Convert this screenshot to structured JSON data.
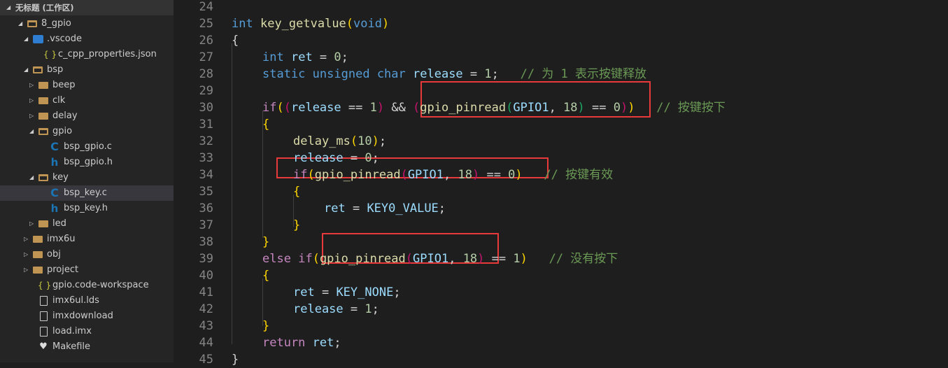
{
  "sidebar": {
    "workspace_title": "无标题 (工作区)",
    "items": [
      {
        "label": "8_gpio",
        "depth": 0,
        "type": "root-folder",
        "expanded": true
      },
      {
        "label": ".vscode",
        "depth": 1,
        "type": "vscode-folder",
        "expanded": true
      },
      {
        "label": "c_cpp_properties.json",
        "depth": 2,
        "type": "json"
      },
      {
        "label": "bsp",
        "depth": 1,
        "type": "folder",
        "expanded": true
      },
      {
        "label": "beep",
        "depth": 2,
        "type": "folder",
        "expanded": false
      },
      {
        "label": "clk",
        "depth": 2,
        "type": "folder",
        "expanded": false
      },
      {
        "label": "delay",
        "depth": 2,
        "type": "folder",
        "expanded": false
      },
      {
        "label": "gpio",
        "depth": 2,
        "type": "folder",
        "expanded": true
      },
      {
        "label": "bsp_gpio.c",
        "depth": 3,
        "type": "c"
      },
      {
        "label": "bsp_gpio.h",
        "depth": 3,
        "type": "h"
      },
      {
        "label": "key",
        "depth": 2,
        "type": "folder",
        "expanded": true
      },
      {
        "label": "bsp_key.c",
        "depth": 3,
        "type": "c",
        "selected": true
      },
      {
        "label": "bsp_key.h",
        "depth": 3,
        "type": "h"
      },
      {
        "label": "led",
        "depth": 2,
        "type": "folder",
        "expanded": false
      },
      {
        "label": "imx6u",
        "depth": 1,
        "type": "folder",
        "expanded": false
      },
      {
        "label": "obj",
        "depth": 1,
        "type": "folder",
        "expanded": false
      },
      {
        "label": "project",
        "depth": 1,
        "type": "folder",
        "expanded": false
      },
      {
        "label": "gpio.code-workspace",
        "depth": 1,
        "type": "json"
      },
      {
        "label": "imx6ul.lds",
        "depth": 1,
        "type": "file"
      },
      {
        "label": "imxdownload",
        "depth": 1,
        "type": "file"
      },
      {
        "label": "load.imx",
        "depth": 1,
        "type": "file"
      },
      {
        "label": "Makefile",
        "depth": 1,
        "type": "makefile"
      }
    ]
  },
  "editor": {
    "lines": [
      {
        "n": "24",
        "indent": 0,
        "tokens": []
      },
      {
        "n": "25",
        "indent": 0,
        "tokens": [
          [
            "int",
            "kw"
          ],
          [
            " ",
            "op"
          ],
          [
            "key_getvalue",
            "fn"
          ],
          [
            "(",
            "b1"
          ],
          [
            "void",
            "kw"
          ],
          [
            ")",
            "b1"
          ]
        ]
      },
      {
        "n": "26",
        "indent": 0,
        "tokens": [
          [
            "{",
            "b0"
          ]
        ]
      },
      {
        "n": "27",
        "indent": 1,
        "tokens": [
          [
            "int",
            "kw"
          ],
          [
            " ",
            "op"
          ],
          [
            "ret",
            "var"
          ],
          [
            " = ",
            "op"
          ],
          [
            "0",
            "num"
          ],
          [
            ";",
            "op"
          ]
        ]
      },
      {
        "n": "28",
        "indent": 1,
        "tokens": [
          [
            "static",
            "kw"
          ],
          [
            " ",
            "op"
          ],
          [
            "unsigned",
            "kw"
          ],
          [
            " ",
            "op"
          ],
          [
            "char",
            "kw"
          ],
          [
            " ",
            "op"
          ],
          [
            "release",
            "var"
          ],
          [
            " = ",
            "op"
          ],
          [
            "1",
            "num"
          ],
          [
            ";   ",
            "op"
          ],
          [
            "// 为 1 表示按键释放",
            "cm"
          ]
        ]
      },
      {
        "n": "29",
        "indent": 0,
        "tokens": []
      },
      {
        "n": "30",
        "indent": 1,
        "tokens": [
          [
            "if",
            "ctl"
          ],
          [
            "(",
            "b1"
          ],
          [
            "(",
            "b2"
          ],
          [
            "release",
            "var"
          ],
          [
            " == ",
            "op"
          ],
          [
            "1",
            "num"
          ],
          [
            ")",
            "b2"
          ],
          [
            " && ",
            "op"
          ],
          [
            "(",
            "b2"
          ],
          [
            "gpio_pinread",
            "fn"
          ],
          [
            "(",
            "b3"
          ],
          [
            "GPIO1",
            "var"
          ],
          [
            ", ",
            "op"
          ],
          [
            "18",
            "num"
          ],
          [
            ")",
            "b3"
          ],
          [
            " == ",
            "op"
          ],
          [
            "0",
            "num"
          ],
          [
            ")",
            "b2"
          ],
          [
            ")",
            "b1"
          ],
          [
            "   ",
            "op"
          ],
          [
            "// 按键按下",
            "cm"
          ]
        ]
      },
      {
        "n": "31",
        "indent": 1,
        "tokens": [
          [
            "{",
            "b1"
          ]
        ]
      },
      {
        "n": "32",
        "indent": 2,
        "tokens": [
          [
            "delay_ms",
            "fn"
          ],
          [
            "(",
            "b1"
          ],
          [
            "10",
            "num"
          ],
          [
            ")",
            "b1"
          ],
          [
            ";",
            "op"
          ]
        ]
      },
      {
        "n": "33",
        "indent": 2,
        "tokens": [
          [
            "release",
            "var"
          ],
          [
            " = ",
            "op"
          ],
          [
            "0",
            "num"
          ],
          [
            ";",
            "op"
          ]
        ]
      },
      {
        "n": "34",
        "indent": 2,
        "tokens": [
          [
            "if",
            "ctl"
          ],
          [
            "(",
            "b1"
          ],
          [
            "gpio_pinread",
            "fn"
          ],
          [
            "(",
            "b2"
          ],
          [
            "GPIO1",
            "var"
          ],
          [
            ", ",
            "op"
          ],
          [
            "18",
            "num"
          ],
          [
            ")",
            "b2"
          ],
          [
            " == ",
            "op"
          ],
          [
            "0",
            "num"
          ],
          [
            ")",
            "b1"
          ],
          [
            "   ",
            "op"
          ],
          [
            "// 按键有效",
            "cm"
          ]
        ]
      },
      {
        "n": "35",
        "indent": 2,
        "tokens": [
          [
            "{",
            "b1"
          ]
        ]
      },
      {
        "n": "36",
        "indent": 3,
        "tokens": [
          [
            "ret",
            "var"
          ],
          [
            " = ",
            "op"
          ],
          [
            "KEY0_VALUE",
            "var"
          ],
          [
            ";",
            "op"
          ]
        ]
      },
      {
        "n": "37",
        "indent": 2,
        "tokens": [
          [
            "}",
            "b1"
          ]
        ]
      },
      {
        "n": "38",
        "indent": 1,
        "tokens": [
          [
            "}",
            "b1"
          ]
        ]
      },
      {
        "n": "39",
        "indent": 1,
        "tokens": [
          [
            "else",
            "ctl"
          ],
          [
            " ",
            "op"
          ],
          [
            "if",
            "ctl"
          ],
          [
            "(",
            "b1"
          ],
          [
            "gpio_pinread",
            "fn"
          ],
          [
            "(",
            "b2"
          ],
          [
            "GPIO1",
            "var"
          ],
          [
            ", ",
            "op"
          ],
          [
            "18",
            "num"
          ],
          [
            ")",
            "b2"
          ],
          [
            " == ",
            "op"
          ],
          [
            "1",
            "num"
          ],
          [
            ")",
            "b1"
          ],
          [
            "   ",
            "op"
          ],
          [
            "// 没有按下",
            "cm"
          ]
        ]
      },
      {
        "n": "40",
        "indent": 1,
        "tokens": [
          [
            "{",
            "b1"
          ]
        ]
      },
      {
        "n": "41",
        "indent": 2,
        "tokens": [
          [
            "ret",
            "var"
          ],
          [
            " = ",
            "op"
          ],
          [
            "KEY_NONE",
            "var"
          ],
          [
            ";",
            "op"
          ]
        ]
      },
      {
        "n": "42",
        "indent": 2,
        "tokens": [
          [
            "release",
            "var"
          ],
          [
            " = ",
            "op"
          ],
          [
            "1",
            "num"
          ],
          [
            ";",
            "op"
          ]
        ]
      },
      {
        "n": "43",
        "indent": 1,
        "tokens": [
          [
            "}",
            "b1"
          ]
        ]
      },
      {
        "n": "44",
        "indent": 1,
        "tokens": [
          [
            "return",
            "ctl"
          ],
          [
            " ",
            "op"
          ],
          [
            "ret",
            "var"
          ],
          [
            ";",
            "op"
          ]
        ]
      },
      {
        "n": "45",
        "indent": 0,
        "tokens": [
          [
            "}",
            "b0"
          ]
        ]
      }
    ]
  },
  "colors": {
    "highlight_box": "#e8393b",
    "selection": "#37373d",
    "sidebar_bg": "#252526",
    "editor_bg": "#1e1e1e"
  }
}
